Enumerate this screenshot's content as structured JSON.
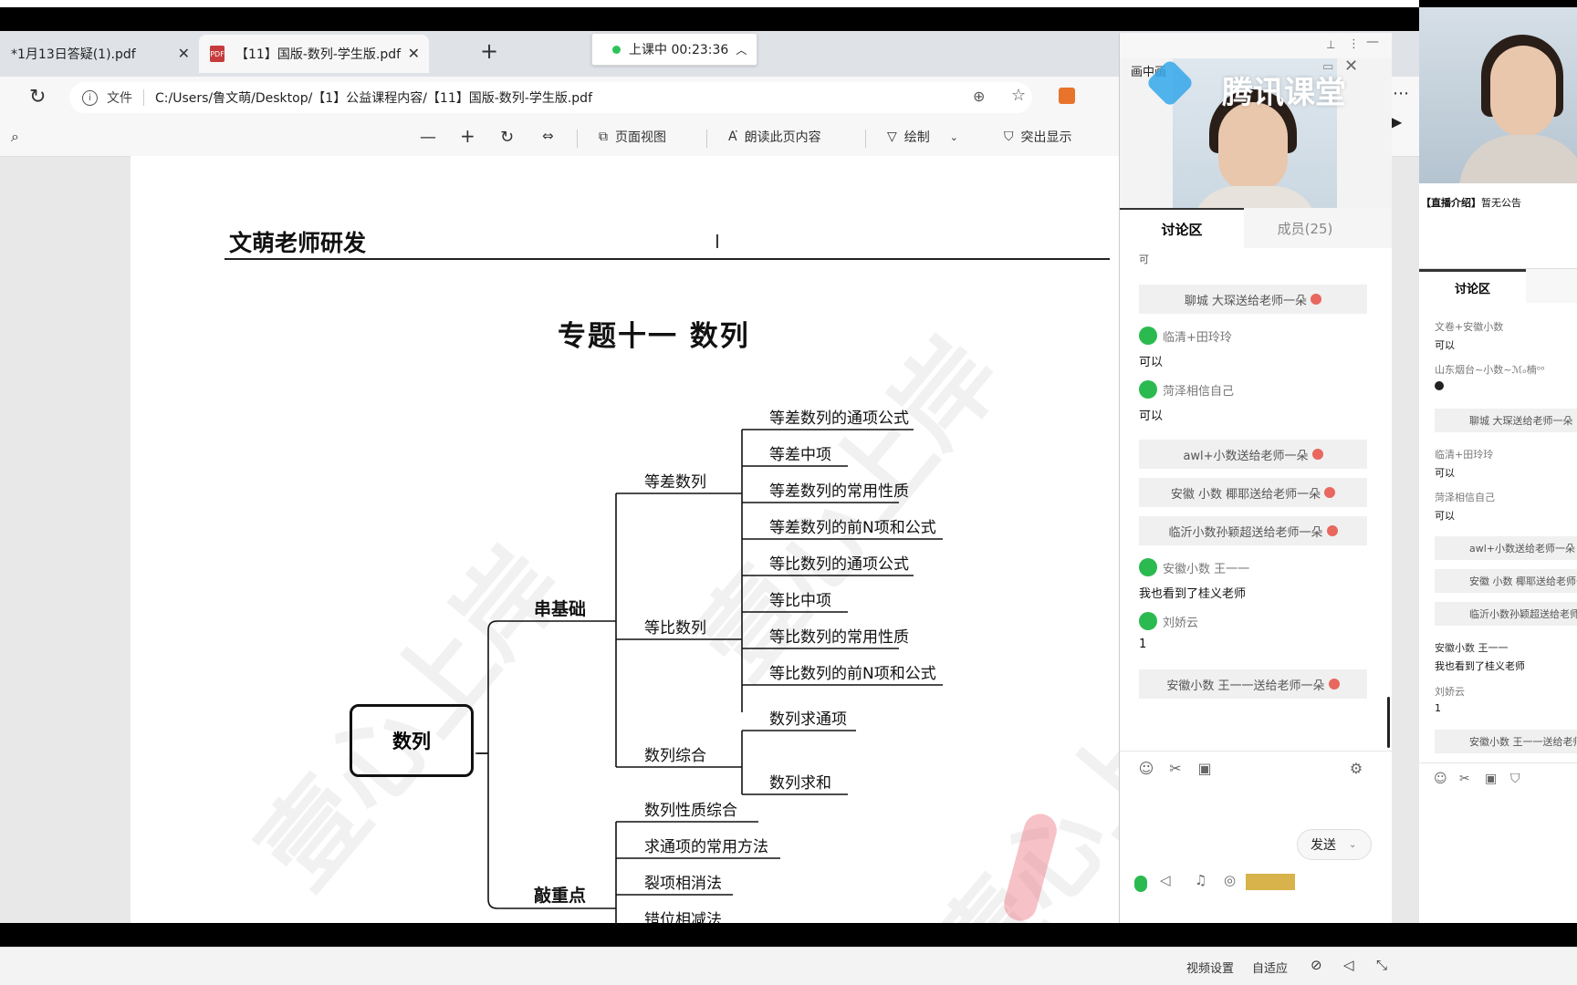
{
  "browser": {
    "tabs": [
      {
        "label": "*1月13日答疑(1).pdf"
      },
      {
        "label": "【11】国版-数列-学生版.pdf"
      }
    ],
    "class_timer": "上课中 00:23:36",
    "address_label": "文件",
    "address_url": "C:/Users/鲁文萌/Desktop/【1】公益课程内容/【11】国版-数列-学生版.pdf",
    "pdf_toolbar": {
      "page_view": "页面视图",
      "read_aloud": "朗读此页内容",
      "draw": "绘制",
      "highlight": "突出显示"
    }
  },
  "document": {
    "header_title": "文萌老师研发",
    "heading": "专题十一    数列",
    "watermark": "壹心上岸",
    "mindmap": {
      "root": "数列",
      "branch_basic": "串基础",
      "branch_key": "敲重点",
      "arith": "等差数列",
      "arith_items": [
        "等差数列的通项公式",
        "等差中项",
        "等差数列的常用性质",
        "等差数列的前N项和公式"
      ],
      "geo": "等比数列",
      "geo_items": [
        "等比数列的通项公式",
        "等比中项",
        "等比数列的常用性质",
        "等比数列的前N项和公式"
      ],
      "comp": "数列综合",
      "comp_items": [
        "数列求通项",
        "数列求和"
      ],
      "key_items": [
        "数列性质综合",
        "求通项的常用方法",
        "裂项相消法",
        "错位相减法"
      ]
    }
  },
  "pip": {
    "title": "画中画",
    "logo": "腾讯课堂",
    "tab_discussion": "讨论区",
    "tab_members": "成员(25)",
    "partial_msg": "可",
    "messages": [
      {
        "type": "system",
        "text": "聊城 大琛送给老师一朵"
      },
      {
        "type": "user",
        "name": "临清+田玲玲",
        "text": "可以"
      },
      {
        "type": "user",
        "name": "菏泽相信自己",
        "text": "可以"
      },
      {
        "type": "system",
        "text": "awl+小数送给老师一朵"
      },
      {
        "type": "system",
        "text": "安徽 小数 椰耶送给老师一朵"
      },
      {
        "type": "system",
        "text": "临沂小数孙颖超送给老师一朵"
      },
      {
        "type": "user",
        "name": "安徽小数 王一一",
        "text": "我也看到了桂义老师"
      },
      {
        "type": "user",
        "name": "刘娇云",
        "text": "1"
      },
      {
        "type": "system",
        "text": "安徽小数 王一一送给老师一朵"
      }
    ],
    "send_label": "发送"
  },
  "right_panel": {
    "announcement_label": "【直播介绍】",
    "announcement_text": "暂无公告",
    "tab_discussion": "讨论区",
    "messages": [
      {
        "type": "name",
        "text": "文卷+安徽小数"
      },
      {
        "type": "msg",
        "text": "可以"
      },
      {
        "type": "name",
        "text": "山东烟台~小数~ℳₒ楠ᵒᵒ"
      },
      {
        "type": "system",
        "text": "聊城 大琛送给老师一朵"
      },
      {
        "type": "name",
        "text": "临清+田玲玲"
      },
      {
        "type": "msg",
        "text": "可以"
      },
      {
        "type": "name",
        "text": "菏泽相信自己"
      },
      {
        "type": "msg",
        "text": "可以"
      },
      {
        "type": "system",
        "text": "awl+小数送给老师一朵"
      },
      {
        "type": "system",
        "text": "安徽 小数 椰耶送给老师一朵"
      },
      {
        "type": "system",
        "text": "临沂小数孙颖超送给老师一朵"
      },
      {
        "type": "name",
        "text": "安徽小数 王一一"
      },
      {
        "type": "msg",
        "text": "我也看到了桂义老师"
      },
      {
        "type": "name",
        "text": "刘娇云"
      },
      {
        "type": "msg",
        "text": "1"
      },
      {
        "type": "system",
        "text": "安徽小数 王一一送给老师一朵"
      }
    ]
  },
  "statusbar": {
    "video_settings": "视频设置",
    "fit": "自适应"
  }
}
